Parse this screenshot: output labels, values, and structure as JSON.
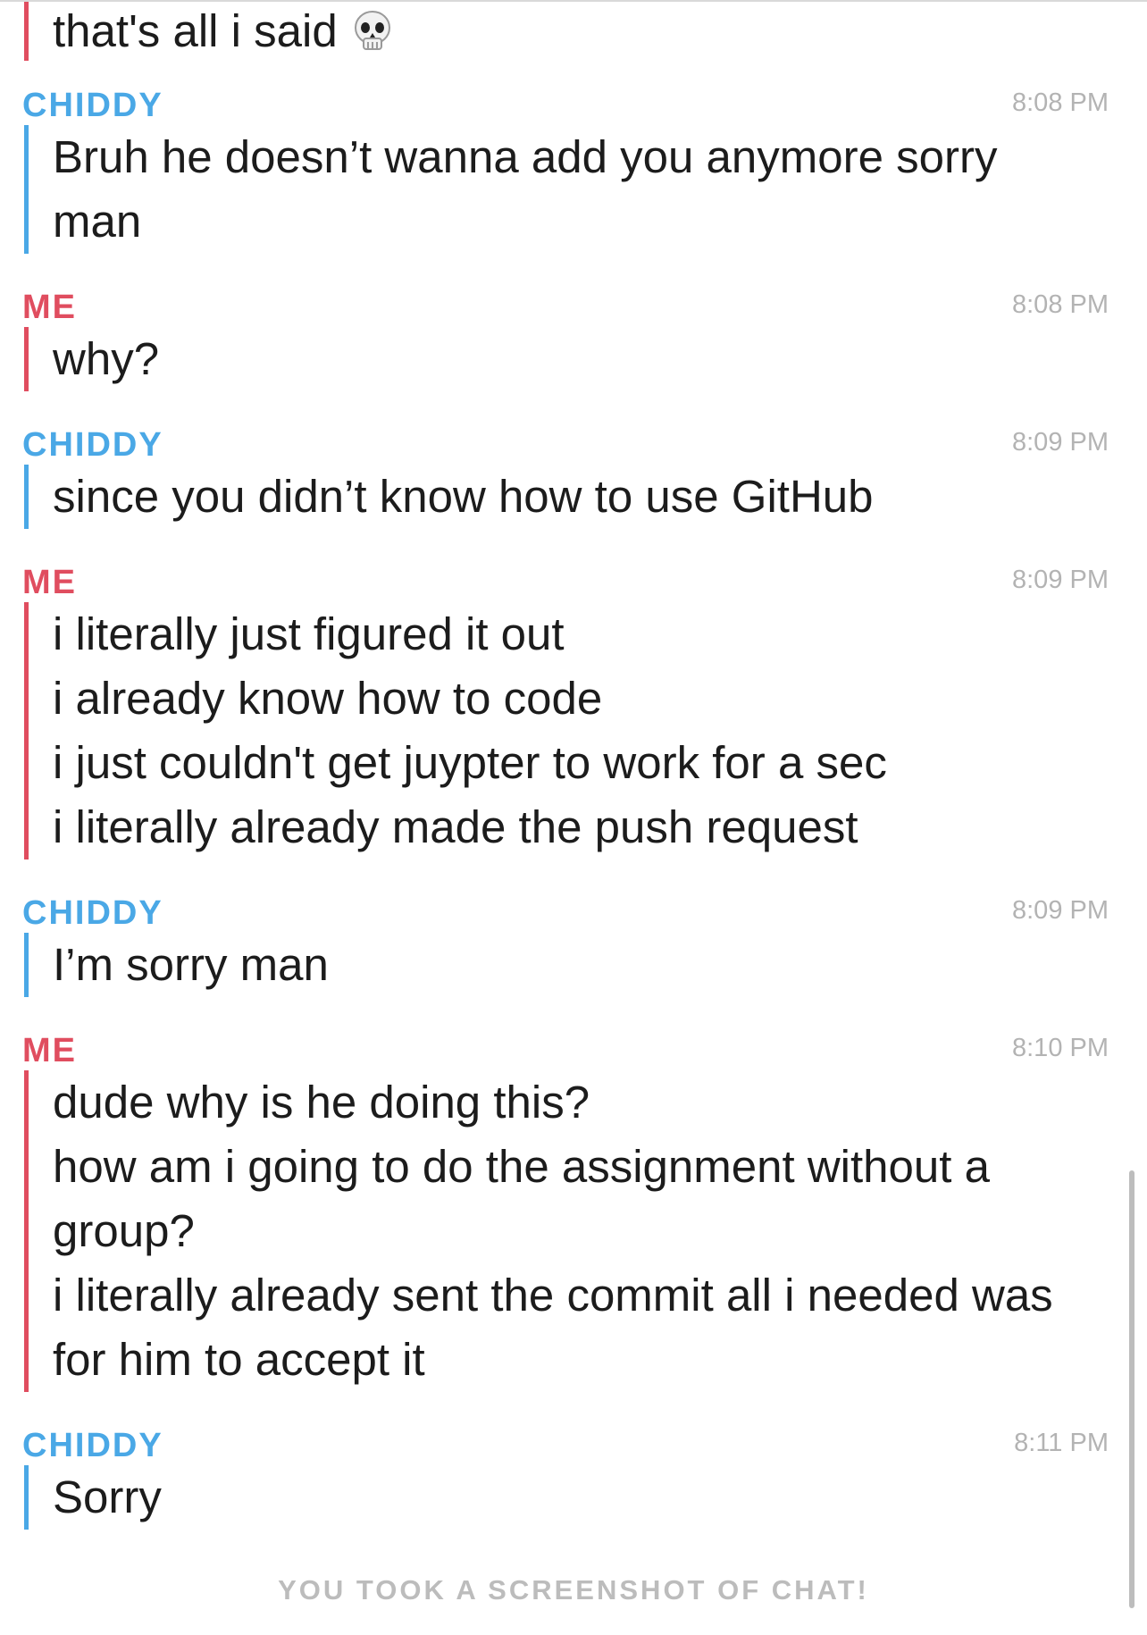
{
  "chat": {
    "first_message": {
      "sender": "me",
      "text": "that's all i said",
      "emoji_icon": "skull-icon"
    },
    "messages": [
      {
        "sender_label": "CHIDDY",
        "sender": "them",
        "time": "8:08 PM",
        "lines": [
          "Bruh he doesn’t wanna add you anymore sorry",
          "man"
        ]
      },
      {
        "sender_label": "ME",
        "sender": "me",
        "time": "8:08 PM",
        "lines": [
          "why?"
        ]
      },
      {
        "sender_label": "CHIDDY",
        "sender": "them",
        "time": "8:09 PM",
        "lines": [
          "since you didn’t know how to use GitHub"
        ]
      },
      {
        "sender_label": "ME",
        "sender": "me",
        "time": "8:09 PM",
        "lines": [
          "i literally just figured it out",
          "i already know how to code",
          "i just couldn't get juypter to work for a sec",
          "i literally already made the push request"
        ]
      },
      {
        "sender_label": "CHIDDY",
        "sender": "them",
        "time": "8:09 PM",
        "lines": [
          "I’m sorry man"
        ]
      },
      {
        "sender_label": "ME",
        "sender": "me",
        "time": "8:10 PM",
        "lines": [
          "dude why is he doing this?",
          "how am i going to do the assignment without a",
          "group?",
          "i literally already sent the commit all i needed was",
          "for him to accept it"
        ]
      },
      {
        "sender_label": "CHIDDY",
        "sender": "them",
        "time": "8:11 PM",
        "lines": [
          "Sorry"
        ]
      }
    ],
    "footer_notice": "YOU TOOK A SCREENSHOT OF CHAT!"
  },
  "colors": {
    "me": "#e04d5f",
    "them": "#4aa8e6",
    "timestamp": "#b3b3b3",
    "notice": "#bcbcbc"
  }
}
